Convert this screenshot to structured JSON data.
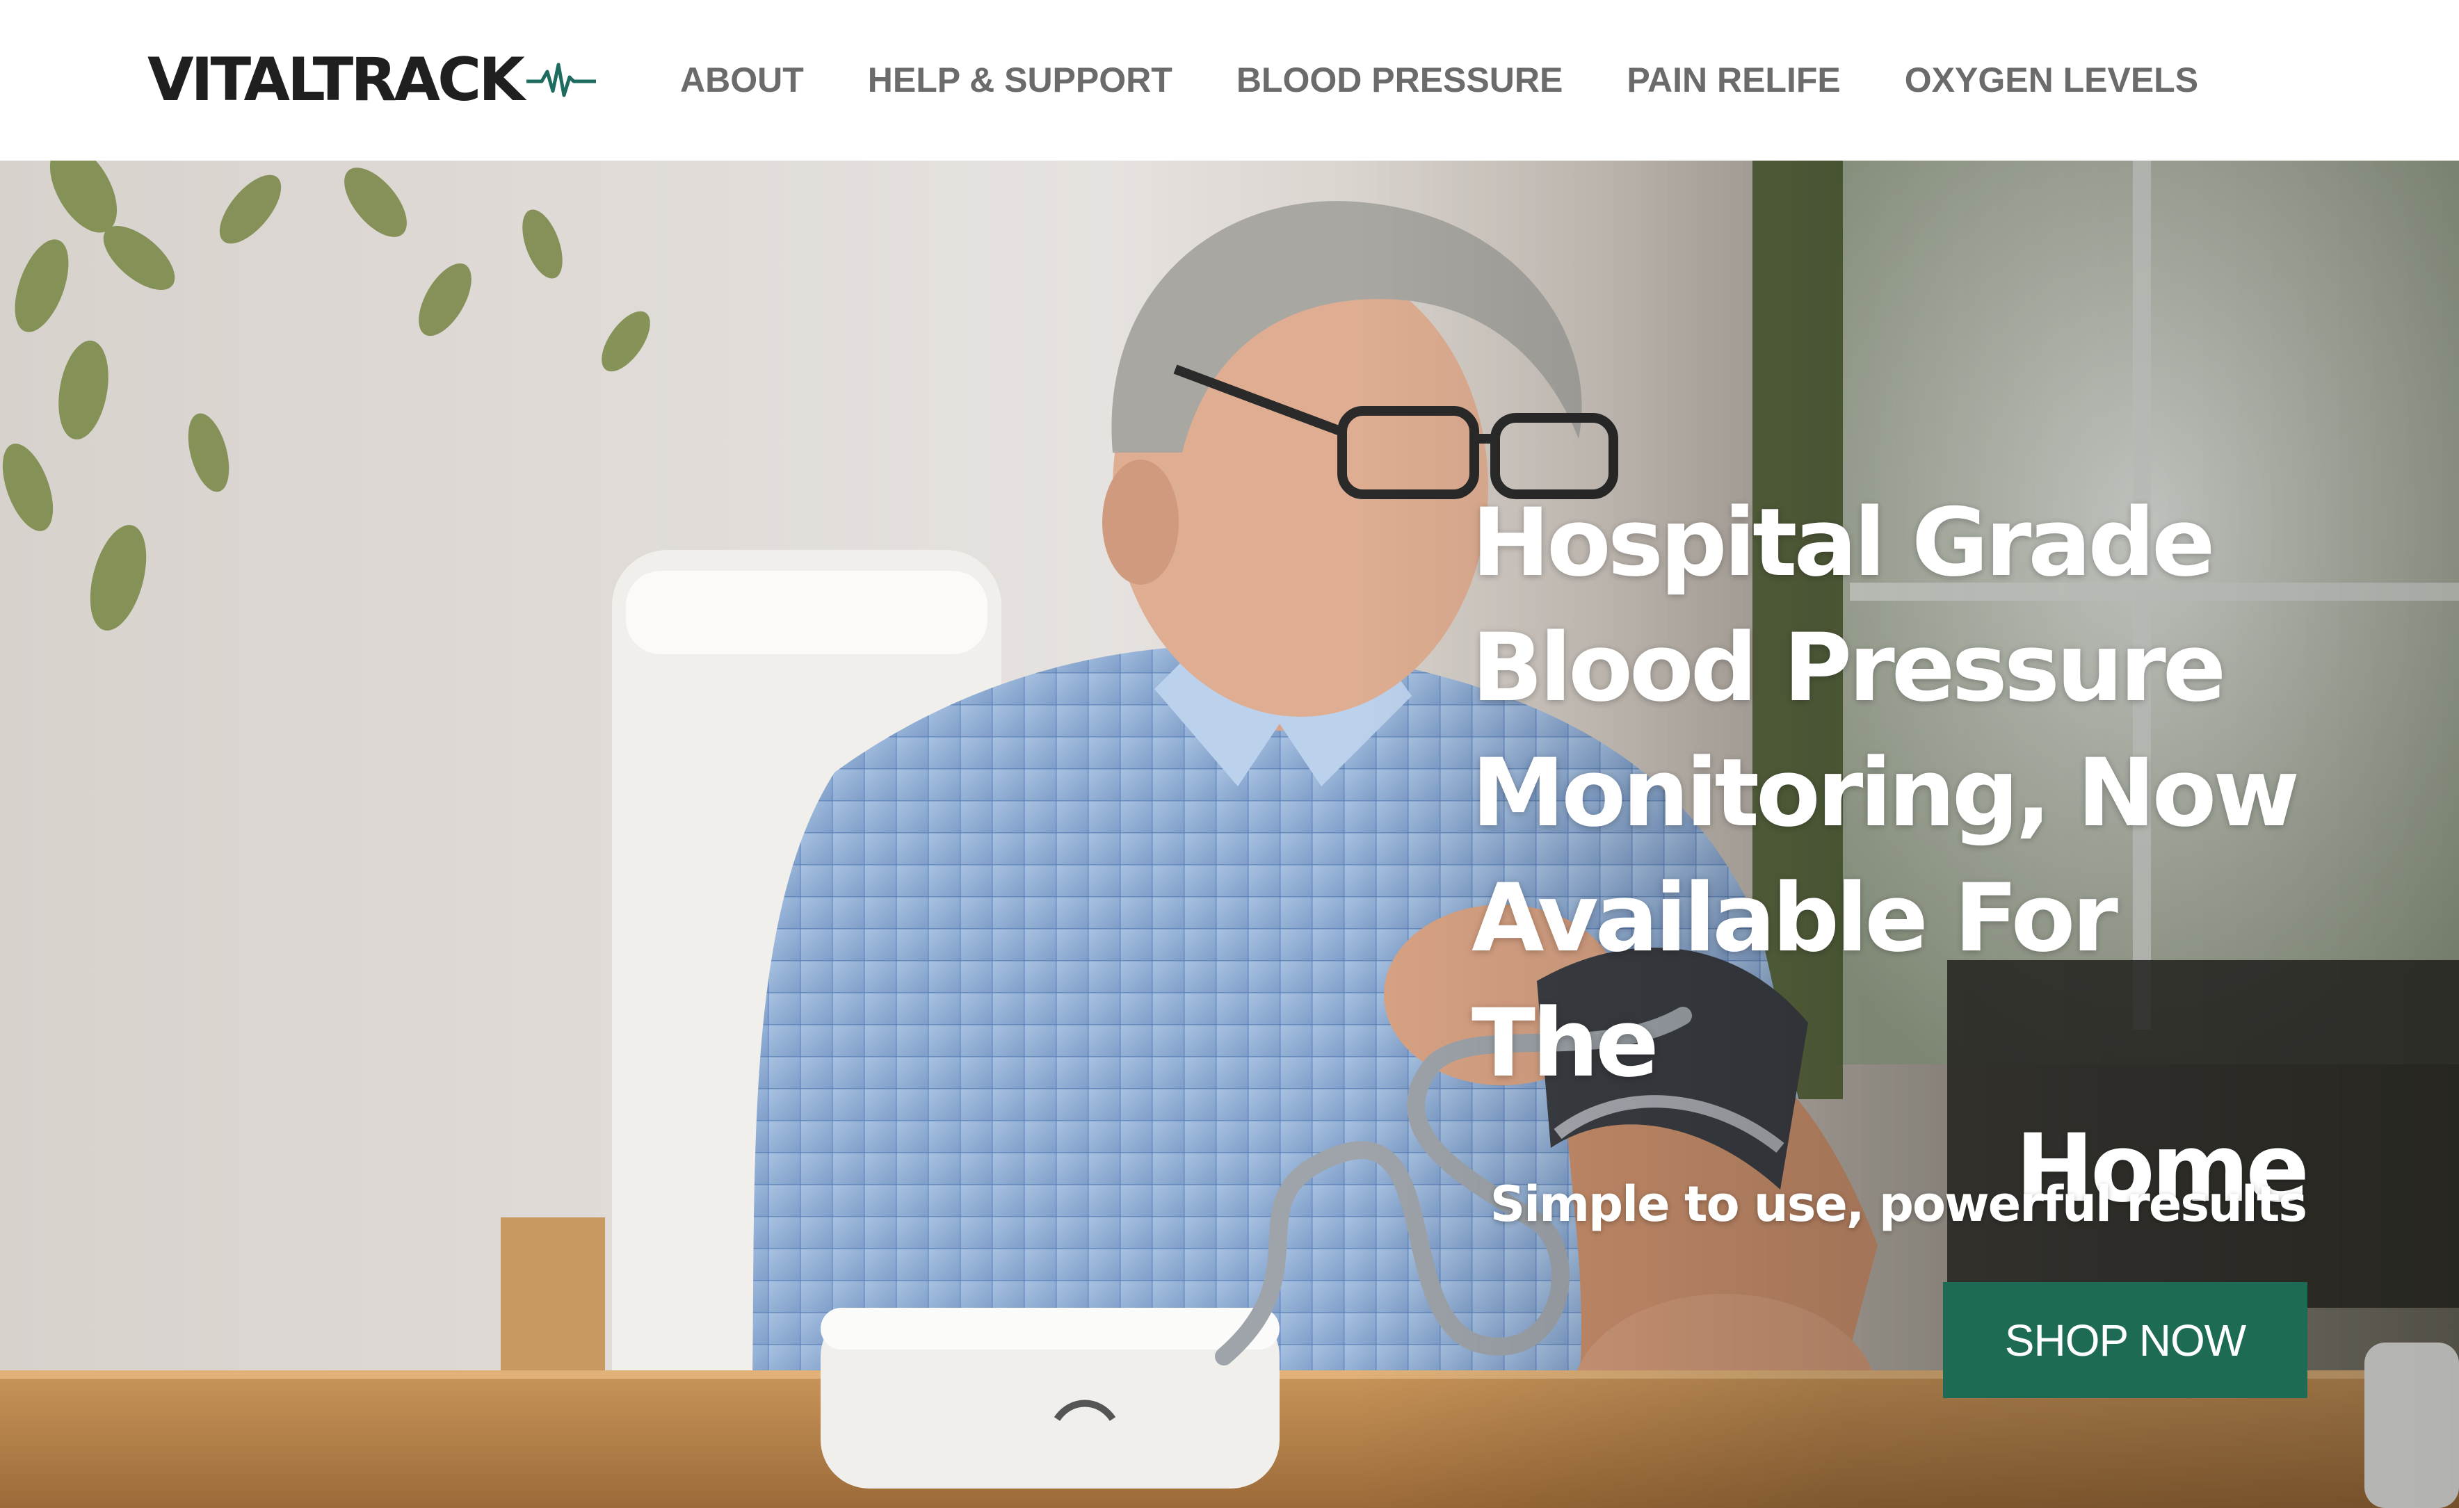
{
  "brand": {
    "name": "VITALTRACK",
    "logo_icon": "heartbeat-pulse-icon",
    "logo_color": "#1e6b60"
  },
  "nav": {
    "items": [
      {
        "label": "ABOUT"
      },
      {
        "label": "HELP & SUPPORT"
      },
      {
        "label": "BLOOD PRESSURE"
      },
      {
        "label": "PAIN RELIFE"
      },
      {
        "label": "OXYGEN LEVELS"
      }
    ]
  },
  "hero": {
    "headline_lines": [
      "Hospital Grade",
      "Blood Pressure",
      "Monitoring, Now",
      "Available For The",
      "Home"
    ],
    "subtitle": "Simple to use, powerful results",
    "cta_label": "SHOP NOW",
    "cta_color": "#1e6b55"
  }
}
